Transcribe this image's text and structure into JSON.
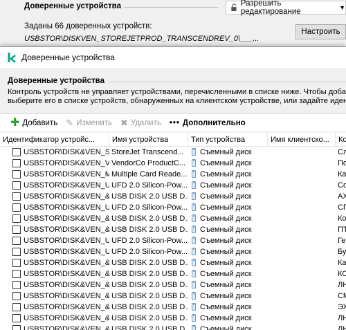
{
  "background_window": {
    "title": "Доверенные устройства",
    "edit_button_label": "Разрешить редактирование",
    "count_text": "Заданы 66 доверенных устройств:",
    "device_path": "USBSTOR\\DISKVEN_STOREJETPROD_TRANSCENDREV_0\\___...",
    "configure_button": "Настроить"
  },
  "dialog": {
    "title": "Доверенные устройства",
    "section_title": "Доверенные устройства",
    "description_line1": "Контроль устройств не управляет устройствами, перечисленными в списке ниже. Чтобы добавить",
    "description_line2": "выберите его в списке устройств, обнаруженных на клиентском устройстве, или задайте идентиф",
    "toolbar": {
      "add": "Добавить",
      "edit": "Изменить",
      "delete": "Удалить",
      "more": "Дополнительно"
    },
    "columns": [
      "Идентификатор устройс...",
      "Имя устройства",
      "Тип устройства",
      "Имя клиентско...",
      "Ко"
    ],
    "rows": [
      {
        "id": "USBSTOR\\DISK&VEN_S...",
        "name": "StoreJet Transcend...",
        "type": "Съемный диск",
        "client": "",
        "c": "Сл"
      },
      {
        "id": "USBSTOR\\DISK&VEN_V...",
        "name": "VendorCo ProductC...",
        "type": "Съемный диск",
        "client": "",
        "c": "По"
      },
      {
        "id": "USBSTOR\\DISK&VEN_M...",
        "name": "Multiple Card Reade...",
        "type": "Съемный диск",
        "client": "",
        "c": "Ка"
      },
      {
        "id": "USBSTOR\\DISK&VEN_U...",
        "name": "UFD 2.0 Silicon-Pow...",
        "type": "Съемный диск",
        "client": "",
        "c": "Со"
      },
      {
        "id": "USBSTOR\\DISK&VEN_&...",
        "name": "USB DISK 2.0 USB D...",
        "type": "Съемный диск",
        "client": "",
        "c": "АХ"
      },
      {
        "id": "USBSTOR\\DISK&VEN_U...",
        "name": "UFD 2.0 Silicon-Pow...",
        "type": "Съемный диск",
        "client": "",
        "c": "СП"
      },
      {
        "id": "USBSTOR\\DISK&VEN_&...",
        "name": "USB DISK 2.0 USB D...",
        "type": "Съемный диск",
        "client": "",
        "c": "Ко"
      },
      {
        "id": "USBSTOR\\DISK&VEN_&...",
        "name": "USB DISK 2.0 USB D...",
        "type": "Съемный диск",
        "client": "",
        "c": "ПТ"
      },
      {
        "id": "USBSTOR\\DISK&VEN_U...",
        "name": "UFD 2.0 Silicon-Pow...",
        "type": "Съемный диск",
        "client": "",
        "c": "Ге"
      },
      {
        "id": "USBSTOR\\DISK&VEN_U...",
        "name": "UFD 2.0 Silicon-Pow...",
        "type": "Съемный диск",
        "client": "",
        "c": "Бу"
      },
      {
        "id": "USBSTOR\\DISK&VEN_&...",
        "name": "USB DISK 2.0 USB D...",
        "type": "Съемный диск",
        "client": "",
        "c": "Ка"
      },
      {
        "id": "USBSTOR\\DISK&VEN_&...",
        "name": "USB DISK 2.0 USB D...",
        "type": "Съемный диск",
        "client": "",
        "c": "КС"
      },
      {
        "id": "USBSTOR\\DISK&VEN_&...",
        "name": "USB DISK 2.0 USB D...",
        "type": "Съемный диск",
        "client": "",
        "c": "ЛН"
      },
      {
        "id": "USBSTOR\\DISK&VEN_&...",
        "name": "USB DISK 2.0 USB D...",
        "type": "Съемный диск",
        "client": "",
        "c": "СМ"
      },
      {
        "id": "USBSTOR\\DISK&VEN_&...",
        "name": "USB DISK 2.0 USB D...",
        "type": "Съемный диск",
        "client": "",
        "c": "ЭХ"
      },
      {
        "id": "USBSTOR\\DISK&VEN_&...",
        "name": "USB DISK 2.0 USB D...",
        "type": "Съемный диск",
        "client": "",
        "c": "ЛН"
      },
      {
        "id": "USBSTOR\\DISK&VEN_&...",
        "name": "USB DISK 2.0 USB D...",
        "type": "Съемный диск",
        "client": "",
        "c": "ЛН"
      }
    ]
  },
  "colors": {
    "accent_green": "#2e9b2e",
    "logo_teal": "#00a88e",
    "usb_blue": "#6a9fd1"
  },
  "icons": {
    "lock": "lock-icon",
    "logo": "kaspersky-logo-icon",
    "add": "plus-icon",
    "edit": "pencil-icon",
    "delete": "x-icon",
    "more": "ellipsis-icon",
    "device": "usb-drive-icon"
  }
}
